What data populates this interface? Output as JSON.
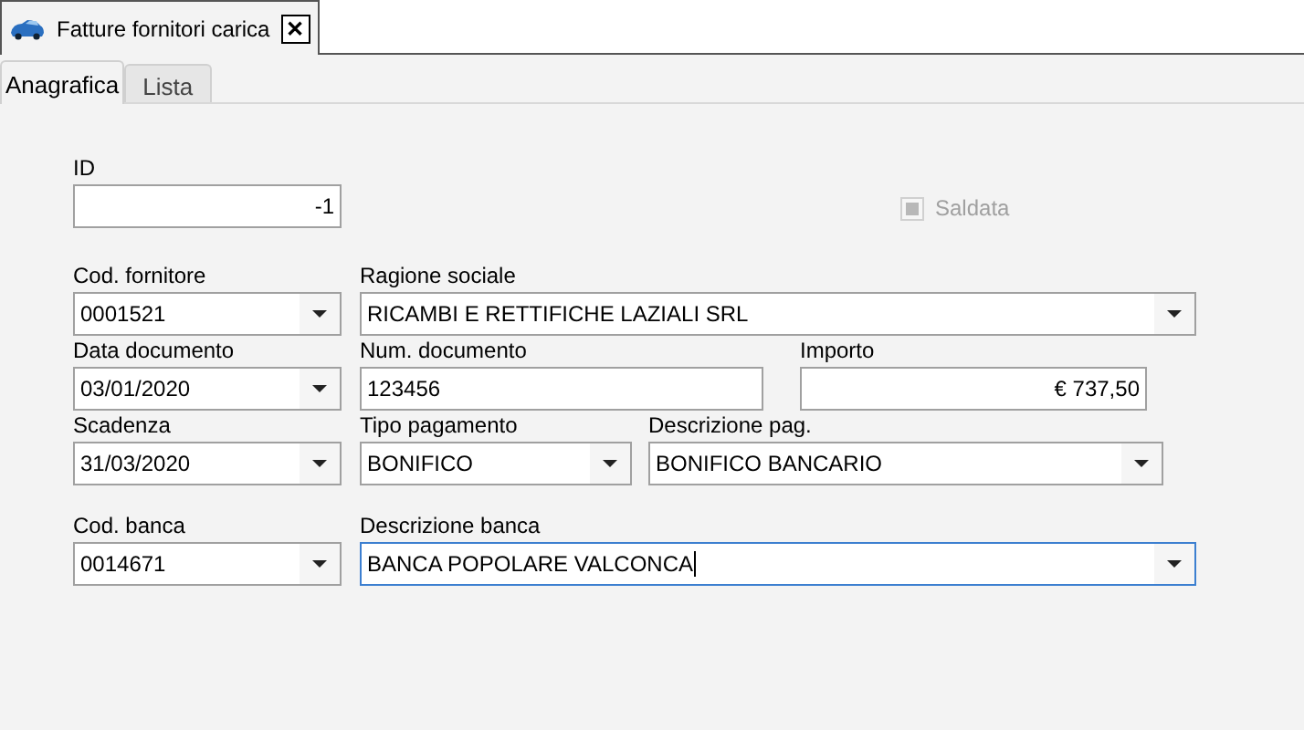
{
  "document_tabs": [
    {
      "label": "Fatture fornitori carica",
      "selected": true,
      "close": "✕"
    }
  ],
  "tabs": [
    {
      "label": "Anagrafica",
      "selected": true
    },
    {
      "label": "Lista",
      "selected": false
    }
  ],
  "form": {
    "rows": [
      {
        "fields": [
          {
            "label": "ID",
            "value": "-1",
            "kind": "number",
            "focused": false
          }
        ],
        "checkbox": {
          "label": "Saldata",
          "checked": true,
          "disabled": true
        }
      },
      {
        "fields": [
          {
            "label": "Cod. fornitore",
            "value": "0001521",
            "kind": "combo",
            "focused": false
          },
          {
            "label": "Ragione sociale",
            "value": "RICAMBI E RETTIFICHE LAZIALI SRL",
            "kind": "combo",
            "focused": false
          }
        ]
      },
      {
        "fields": [
          {
            "label": "Data documento",
            "value": "03/01/2020",
            "kind": "combo",
            "focused": false
          },
          {
            "label": "Num. documento",
            "value": "123456",
            "kind": "text",
            "focused": false
          },
          {
            "label": "Importo",
            "value": "€ 737,50",
            "kind": "number",
            "focused": false
          }
        ]
      },
      {
        "fields": [
          {
            "label": "Scadenza",
            "value": "31/03/2020",
            "kind": "combo",
            "focused": false
          },
          {
            "label": "Tipo pagamento",
            "value": "BONIFICO",
            "kind": "combo",
            "focused": false
          },
          {
            "label": "Descrizione pag.",
            "value": "BONIFICO BANCARIO",
            "kind": "combo",
            "focused": false
          }
        ]
      },
      {
        "fields": [
          {
            "label": "Cod. banca",
            "value": "0014671",
            "kind": "combo",
            "focused": false
          },
          {
            "label": "Descrizione banca",
            "value": "BANCA POPOLARE VALCONCA",
            "kind": "combo",
            "focused": true
          }
        ]
      }
    ]
  }
}
